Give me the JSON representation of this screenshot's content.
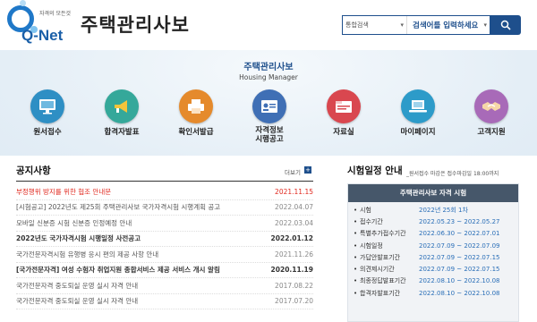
{
  "header": {
    "logo_tagline": "자격의 모든것",
    "logo_text": "Q-Net",
    "site_title": "주택관리사보",
    "search_scope": "통합검색",
    "search_placeholder": "검색어를 입력하세요"
  },
  "banner": {
    "title": "주택관리사보",
    "subtitle": "Housing Manager",
    "menu": [
      {
        "label": "원서접수",
        "icon": "monitor-icon",
        "color": "#2e8fc4"
      },
      {
        "label": "합격자발표",
        "icon": "megaphone-icon",
        "color": "#35a89a"
      },
      {
        "label": "확인서발급",
        "icon": "printer-icon",
        "color": "#e58a2c"
      },
      {
        "label": "자격정보\n시행공고",
        "icon": "id-card-icon",
        "color": "#3f6fb5"
      },
      {
        "label": "자료실",
        "icon": "folder-icon",
        "color": "#d9474f"
      },
      {
        "label": "마이페이지",
        "icon": "laptop-icon",
        "color": "#2d9bc9"
      },
      {
        "label": "고객지원",
        "icon": "handshake-icon",
        "color": "#a86ab8"
      }
    ]
  },
  "notices": {
    "title": "공지사항",
    "more_label": "더보기",
    "items": [
      {
        "title": "부정행위 방지를 위한 협조 안내문",
        "date": "2021.11.15",
        "style": "red"
      },
      {
        "title": "[시험공고] 2022년도 제25회 주택관리사보 국가자격시험 시행계획 공고",
        "date": "2022.04.07",
        "style": "normal"
      },
      {
        "title": "모바일 신분증 시험 신분증 인정예정 안내",
        "date": "2022.03.04",
        "style": "normal"
      },
      {
        "title": "2022년도 국가자격시험 시행일정 사전공고",
        "date": "2022.01.12",
        "style": "bold"
      },
      {
        "title": "국가전문자격시험 유행병 응시 편의 제공 사항 안내",
        "date": "2021.11.26",
        "style": "normal"
      },
      {
        "title": "[국가전문자격] 여성 수험자 취업지원 종합서비스 제공 서비스 개시 알림",
        "date": "2020.11.19",
        "style": "bold"
      },
      {
        "title": "국가전문자격 중도퇴실 운영 실시 자격 안내",
        "date": "2017.08.22",
        "style": "normal"
      },
      {
        "title": "국가전문자격 중도퇴실 운영 실시 자격 안내",
        "date": "2017.07.20",
        "style": "normal"
      }
    ]
  },
  "schedule": {
    "title": "시험일정 안내",
    "note": "_원서접수 마감은 접수마감일 18:00까지",
    "box_title": "주택관리사보 자격 시험",
    "rows": [
      {
        "label": "시험",
        "value": "2022년 25회 1차"
      },
      {
        "label": "접수기간",
        "value": "2022.05.23 ~ 2022.05.27"
      },
      {
        "label": "특별추가접수기간",
        "value": "2022.06.30 ~ 2022.07.01"
      },
      {
        "label": "시험일정",
        "value": "2022.07.09 ~ 2022.07.09"
      },
      {
        "label": "가답안발표기간",
        "value": "2022.07.09 ~ 2022.07.15"
      },
      {
        "label": "의견제시기간",
        "value": "2022.07.09 ~ 2022.07.15"
      },
      {
        "label": "최종정답발표기간",
        "value": "2022.08.10 ~ 2022.10.08"
      },
      {
        "label": "합격자발표기간",
        "value": "2022.08.10 ~ 2022.10.08"
      }
    ]
  }
}
